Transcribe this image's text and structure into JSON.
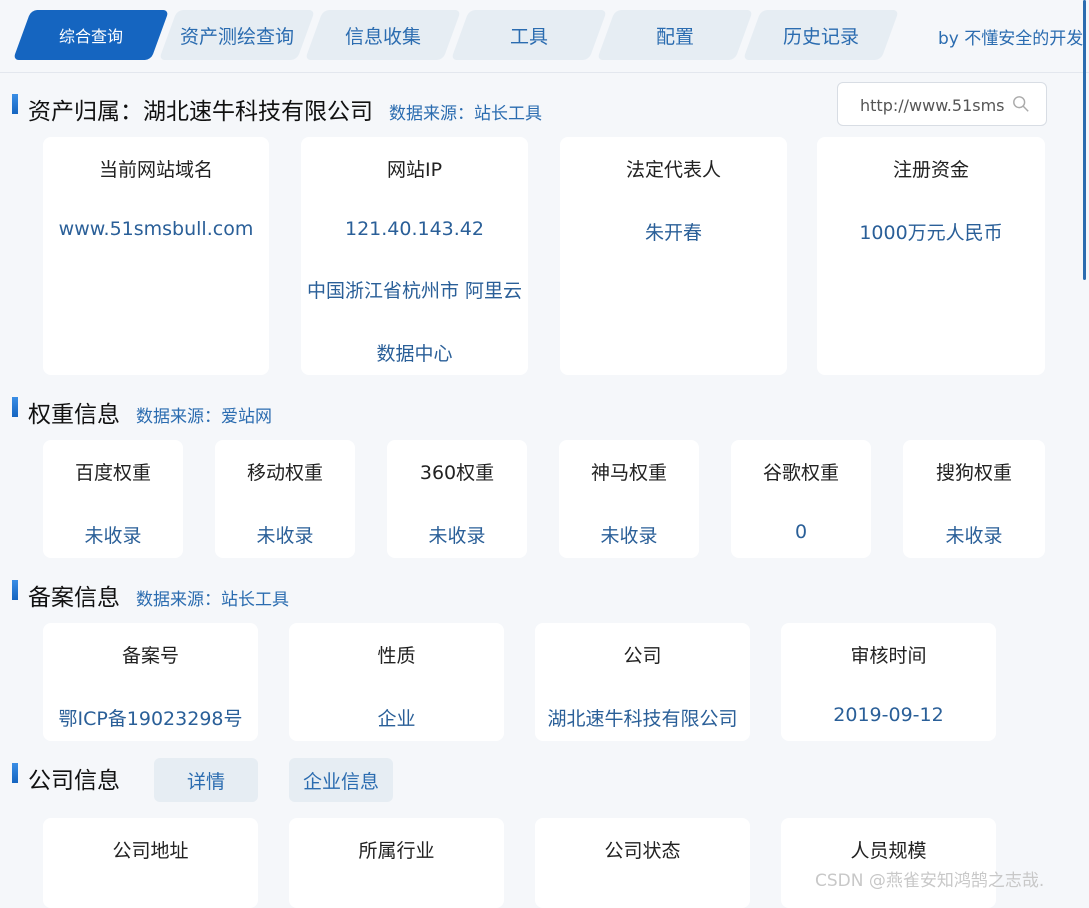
{
  "tabs": [
    {
      "label": "综合查询"
    },
    {
      "label": "资产测绘查询"
    },
    {
      "label": "信息收集"
    },
    {
      "label": "工具"
    },
    {
      "label": "配置"
    },
    {
      "label": "历史记录"
    }
  ],
  "byline": "by 不懂安全的开发",
  "asset": {
    "title": "资产归属：湖北速牛科技有限公司",
    "source": "数据来源：站长工具",
    "search_value": "http://www.51sms",
    "cards": [
      {
        "title": "当前网站域名",
        "value": "www.51smsbull.com"
      },
      {
        "title": "网站IP",
        "value": "121.40.143.42",
        "value2": "中国浙江省杭州市 阿里云",
        "value3": "数据中心"
      },
      {
        "title": "法定代表人",
        "value": "朱开春"
      },
      {
        "title": "注册资金",
        "value": "1000万元人民币"
      }
    ]
  },
  "weight": {
    "title": "权重信息",
    "source": "数据来源：爱站网",
    "cards": [
      {
        "title": "百度权重",
        "value": "未收录"
      },
      {
        "title": "移动权重",
        "value": "未收录"
      },
      {
        "title": "360权重",
        "value": "未收录"
      },
      {
        "title": "神马权重",
        "value": "未收录"
      },
      {
        "title": "谷歌权重",
        "value": "0"
      },
      {
        "title": "搜狗权重",
        "value": "未收录"
      }
    ]
  },
  "icp": {
    "title": "备案信息",
    "source": "数据来源：站长工具",
    "cards": [
      {
        "title": "备案号",
        "value": "鄂ICP备19023298号"
      },
      {
        "title": "性质",
        "value": "企业"
      },
      {
        "title": "公司",
        "value": "湖北速牛科技有限公司"
      },
      {
        "title": "审核时间",
        "value": "2019-09-12"
      }
    ]
  },
  "company": {
    "title": "公司信息",
    "buttons": [
      "详情",
      "企业信息"
    ],
    "cards": [
      {
        "title": "公司地址"
      },
      {
        "title": "所属行业"
      },
      {
        "title": "公司状态"
      },
      {
        "title": "人员规模"
      }
    ]
  },
  "watermark": "CSDN @燕雀安知鸿鹄之志哉.",
  "colors": {
    "accent": "#1565c0",
    "value_text": "#2a5f98",
    "tab_bg": "#e6edf3"
  },
  "icons": {
    "search": "search-icon"
  }
}
